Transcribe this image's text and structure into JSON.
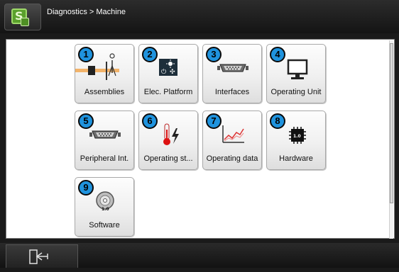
{
  "header": {
    "breadcrumb": "Diagnostics > Machine",
    "logo_icon": "machine-logo-icon"
  },
  "tiles": [
    {
      "number": "1",
      "label": "Assemblies",
      "icon": "assemblies-icon"
    },
    {
      "number": "2",
      "label": "Elec. Platform",
      "icon": "electrical-platform-icon"
    },
    {
      "number": "3",
      "label": "Interfaces",
      "icon": "interface-connector-icon"
    },
    {
      "number": "4",
      "label": "Operating Unit",
      "icon": "monitor-icon"
    },
    {
      "number": "5",
      "label": "Peripheral Int.",
      "icon": "interface-connector-icon"
    },
    {
      "number": "6",
      "label": "Operating st...",
      "icon": "thermometer-lightning-icon"
    },
    {
      "number": "7",
      "label": "Operating data",
      "icon": "line-chart-icon"
    },
    {
      "number": "8",
      "label": "Hardware",
      "icon": "chip-icon"
    },
    {
      "number": "9",
      "label": "Software",
      "icon": "disc-icon"
    }
  ],
  "footer": {
    "exit_icon": "exit-door-icon"
  },
  "colors": {
    "badge": "#1f93de",
    "logo_green": "#5aa02c",
    "header_bg": "#1a1a1a"
  }
}
